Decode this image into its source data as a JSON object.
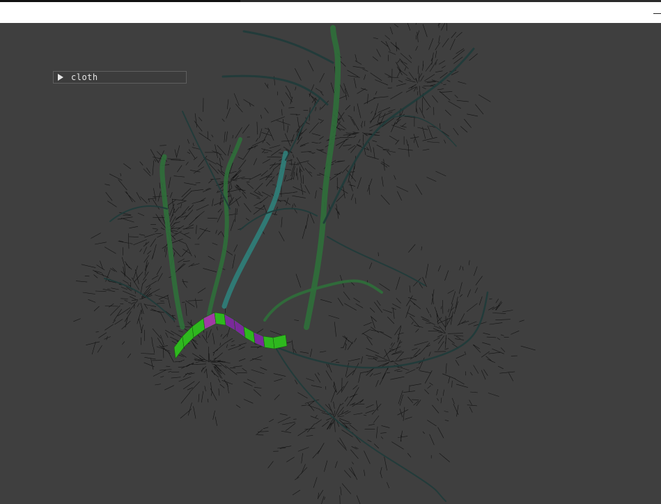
{
  "window": {
    "background_color": "#3f3f3f",
    "title_bar_color": "#ffffff",
    "minimize_icon": "minimize-icon"
  },
  "panel": {
    "cloth_label": "cloth",
    "collapsed": true,
    "arrow_icon": "triangle-right-icon"
  },
  "scene": {
    "description_colors": {
      "branch_dark": "#1f3b3a",
      "branch_green": "#2f6f3a",
      "branch_teal": "#2f7f7a",
      "twig": "#0a0a0a",
      "cloth_green": "#2eb81e",
      "cloth_purple": "#7a2a9a",
      "cloth_magenta": "#a13aa5"
    }
  }
}
